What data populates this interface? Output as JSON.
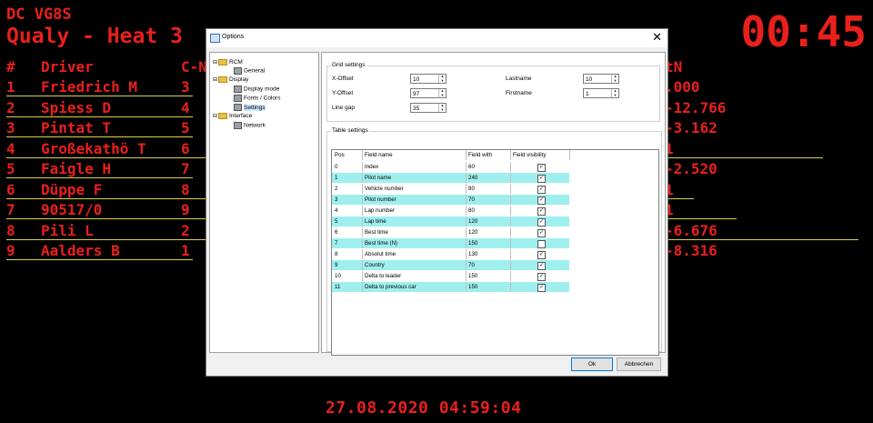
{
  "scoreboard": {
    "subtitle": "DC VG8S",
    "title": "Qualy - Heat 3",
    "clock": "00:45",
    "datetime": "27.08.2020 04:59:04",
    "headers": {
      "idx": "#",
      "driver": "Driver",
      "cn": "C-N",
      "dt": "tN"
    },
    "rows": [
      {
        "idx": "1",
        "driver": "Friedrich M",
        "cn": "3",
        "dt": ".000"
      },
      {
        "idx": "2",
        "driver": "Spiess D",
        "cn": "4",
        "dt": "-12.766"
      },
      {
        "idx": "3",
        "driver": "Pintat T",
        "cn": "5",
        "dt": "-3.162"
      },
      {
        "idx": "4",
        "driver": "Großekathö T",
        "cn": "6",
        "dt": "1"
      },
      {
        "idx": "5",
        "driver": "Faigle H",
        "cn": "7",
        "dt": "-2.520"
      },
      {
        "idx": "6",
        "driver": "Düppe F",
        "cn": "8",
        "dt": "1"
      },
      {
        "idx": "7",
        "driver": "90517/0",
        "cn": "9",
        "dt": "1"
      },
      {
        "idx": "8",
        "driver": "Pili L",
        "cn": "2",
        "dt": "-6.676"
      },
      {
        "idx": "9",
        "driver": "Aalders B",
        "cn": "1",
        "dt": "-8.316"
      }
    ]
  },
  "dialog": {
    "title": "Options",
    "close": "✕",
    "tree": {
      "rcm": "RCM",
      "general": "General",
      "display": "Display",
      "display_mode": "Display mode",
      "fonts_colors": "Fonts / Colors",
      "settings": "Settings",
      "interface": "Interface",
      "network": "Network"
    },
    "grid_settings": {
      "label": "Grid settings",
      "x_offset_label": "X-Offset",
      "x_offset": "10",
      "y_offset_label": "Y-Offset",
      "y_offset": "97",
      "line_gap_label": "Line gap",
      "line_gap": "35",
      "lastname_label": "Lastname",
      "lastname": "10",
      "firstname_label": "Firstname",
      "firstname": "1"
    },
    "table_settings": {
      "label": "Table settings",
      "columns": [
        "Pos",
        "Field name",
        "Field with",
        "Field visibility"
      ],
      "rows": [
        {
          "pos": "0",
          "name": "Index",
          "width": "60",
          "visible": true
        },
        {
          "pos": "1",
          "name": "Pilot name",
          "width": "240",
          "visible": true
        },
        {
          "pos": "2",
          "name": "Vehicle number",
          "width": "80",
          "visible": true
        },
        {
          "pos": "3",
          "name": "Pilot number",
          "width": "70",
          "visible": true
        },
        {
          "pos": "4",
          "name": "Lap number",
          "width": "80",
          "visible": true
        },
        {
          "pos": "5",
          "name": "Lap time",
          "width": "120",
          "visible": true
        },
        {
          "pos": "6",
          "name": "Best time",
          "width": "120",
          "visible": true
        },
        {
          "pos": "7",
          "name": "Best time (N)",
          "width": "150",
          "visible": false
        },
        {
          "pos": "8",
          "name": "Absolut time",
          "width": "130",
          "visible": true
        },
        {
          "pos": "9",
          "name": "Country",
          "width": "70",
          "visible": true
        },
        {
          "pos": "10",
          "name": "Delta to leader",
          "width": "150",
          "visible": true
        },
        {
          "pos": "11",
          "name": "Delta to previous car",
          "width": "150",
          "visible": true
        }
      ]
    },
    "ok": "Ok",
    "cancel": "Abbrechen"
  }
}
